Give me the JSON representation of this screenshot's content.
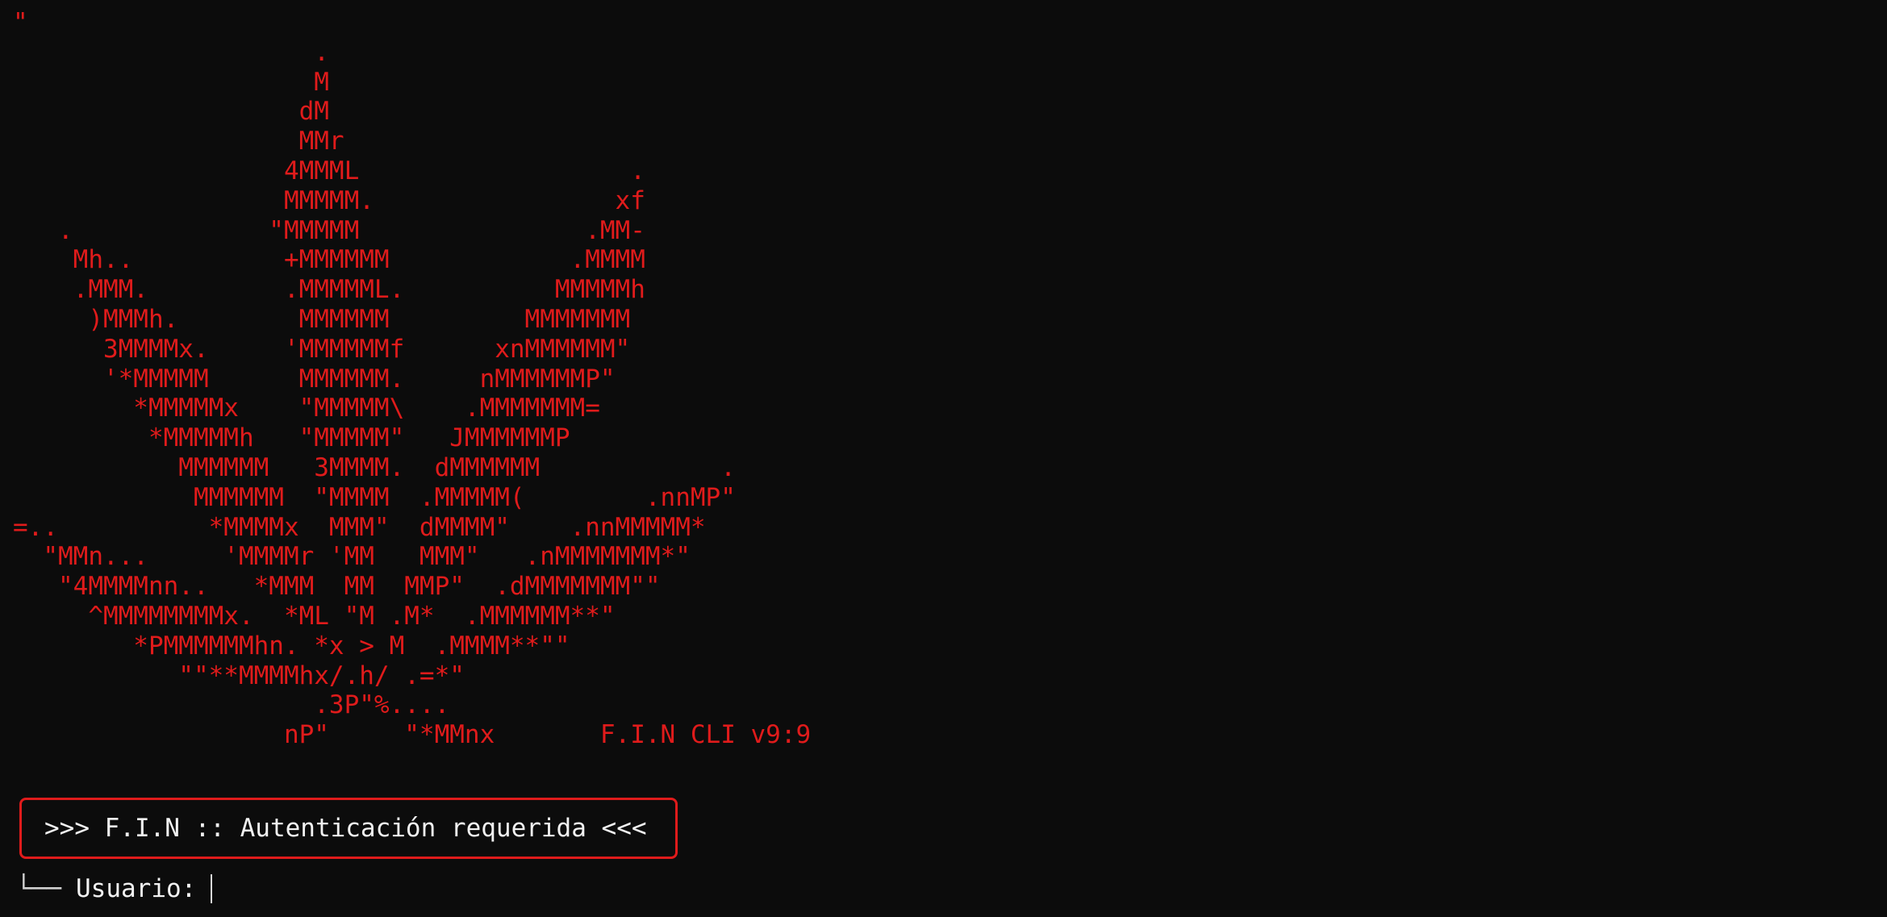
{
  "terminal": {
    "banner_lines": [
      "\"",
      "                    .",
      "                    M",
      "                   dM",
      "                   MMr",
      "                  4MMML                  .",
      "                  MMMMM.                xf",
      "   .             \"MMMMM               .MM-",
      "    Mh..          +MMMMMM            .MMMM",
      "    .MMM.         .MMMMML.          MMMMMh",
      "     )MMMh.        MMMMMM         MMMMMMM",
      "      3MMMMx.     'MMMMMMf      xnMMMMMM\"",
      "      '*MMMMM      MMMMMM.     nMMMMMMP\"",
      "        *MMMMMx    \"MMMMM\\    .MMMMMMM=",
      "         *MMMMMh   \"MMMMM\"   JMMMMMMP",
      "           MMMMMM   3MMMM.  dMMMMMM            .",
      "            MMMMMM  \"MMMM  .MMMMM(        .nnMP\"",
      "=..          *MMMMx  MMM\"  dMMMM\"    .nnMMMMM*",
      "  \"MMn...     'MMMMr 'MM   MMM\"   .nMMMMMMM*\"",
      "   \"4MMMMnn..   *MMM  MM  MMP\"  .dMMMMMMM\"\"",
      "     ^MMMMMMMMx.  *ML \"M .M*  .MMMMMM**\"",
      "        *PMMMMMMhn. *x > M  .MMMM**\"\"",
      "           \"\"**MMMMhx/.h/ .=*\"",
      "                    .3P\"%....",
      "                  nP\"     \"*MMnx       F.I.N CLI v9:9"
    ],
    "auth_box": {
      "text": ">>> F.I.N :: Autenticación requerida <<<"
    },
    "prompt": {
      "tree_glyph": "└──",
      "label": "Usuario:",
      "value": ""
    },
    "colors": {
      "background": "#0c0c0c",
      "art": "#e01b1b",
      "text": "#f2f2f2",
      "box_border": "#e01b1b"
    }
  }
}
